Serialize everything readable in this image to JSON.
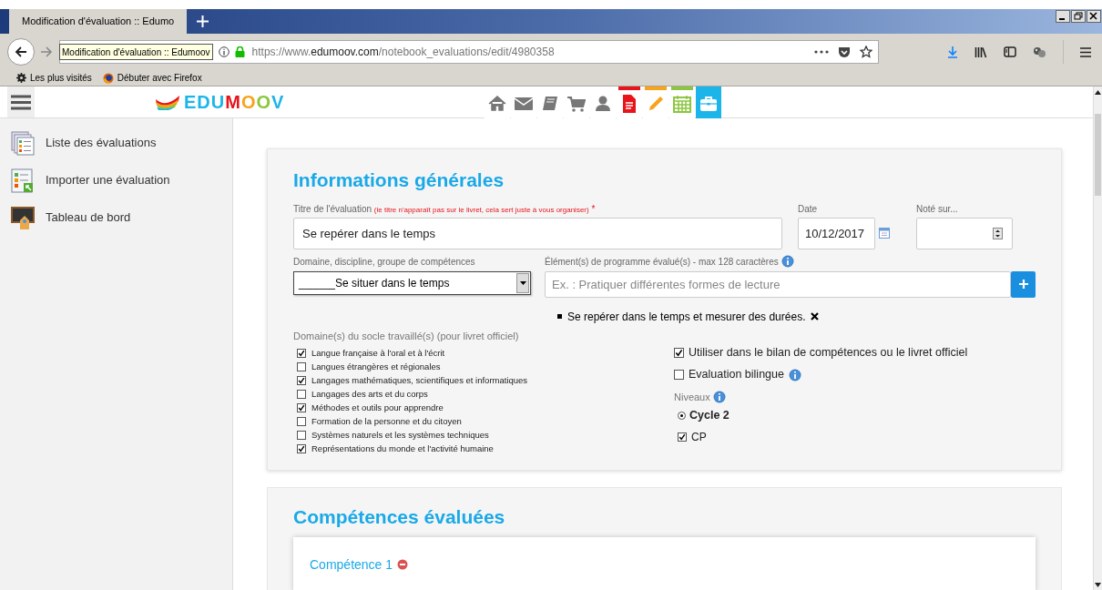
{
  "browser": {
    "tab": {
      "title": "Modification d'évaluation :: Edumo"
    },
    "tooltip": "Modification d'évaluation :: Edumoov",
    "url": {
      "prefix": "https://www.",
      "domain": "edumoov.com",
      "path": "/notebook_evaluations/edit/4980358"
    },
    "bookmarks": [
      "Les plus visités",
      "Débuter avec Firefox"
    ]
  },
  "app": {
    "logo": "EDUMOOV",
    "nav": [
      {
        "selected": false
      },
      {
        "selected": false
      },
      {
        "selected": false
      },
      {
        "selected": false
      },
      {
        "selected": false
      },
      {
        "selected": false,
        "color": "#e8141b"
      },
      {
        "selected": false,
        "color": "#f7a31b"
      },
      {
        "selected": false,
        "color": "#8cc63f"
      },
      {
        "selected": true
      }
    ]
  },
  "sidebar": {
    "items": [
      {
        "label": "Liste des évaluations"
      },
      {
        "label": "Importer une évaluation"
      },
      {
        "label": "Tableau de bord"
      }
    ]
  },
  "general": {
    "title": "Informations générales",
    "eval_title": {
      "label": "Titre de l'évaluation",
      "hint": "(le titre n'apparaît pas sur le livret, cela sert juste à vous organiser)",
      "required": "*",
      "value": "Se repérer dans le temps"
    },
    "date": {
      "label": "Date",
      "value": "10/12/2017"
    },
    "note": {
      "label": "Noté sur..."
    },
    "domain": {
      "label": "Domaine, discipline, groupe de compétences",
      "value": "______Se situer dans le temps"
    },
    "elements": {
      "label": "Élément(s) de programme évalué(s) - max 128 caractères",
      "placeholder": "Ex. : Pratiquer différentes formes de lecture",
      "items": [
        "Se repérer dans le temps et mesurer des durées."
      ]
    },
    "socle": {
      "label": "Domaine(s) du socle travaillé(s) (pour livret officiel)",
      "items": [
        {
          "label": "Langue française à l'oral et à l'écrit",
          "checked": true
        },
        {
          "label": "Langues étrangères et régionales",
          "checked": false
        },
        {
          "label": "Langages mathématiques, scientifiques et informatiques",
          "checked": true
        },
        {
          "label": "Langages des arts et du corps",
          "checked": false
        },
        {
          "label": "Méthodes et outils pour apprendre",
          "checked": true
        },
        {
          "label": "Formation de la personne et du citoyen",
          "checked": false
        },
        {
          "label": "Systèmes naturels et les systèmes techniques",
          "checked": false
        },
        {
          "label": "Représentations du monde et l'activité humaine",
          "checked": true
        }
      ]
    },
    "options": [
      {
        "label": "Utiliser dans le bilan de compétences ou le livret officiel",
        "checked": true,
        "info": false
      },
      {
        "label": "Evaluation bilingue",
        "checked": false,
        "info": true
      }
    ],
    "levels": {
      "label": "Niveaux",
      "cycle": {
        "label": "Cycle 2",
        "selected": true
      },
      "classes": [
        {
          "label": "CP",
          "checked": true
        }
      ]
    }
  },
  "competences": {
    "title": "Compétences évaluées",
    "items": [
      {
        "label": "Compétence 1"
      }
    ]
  }
}
